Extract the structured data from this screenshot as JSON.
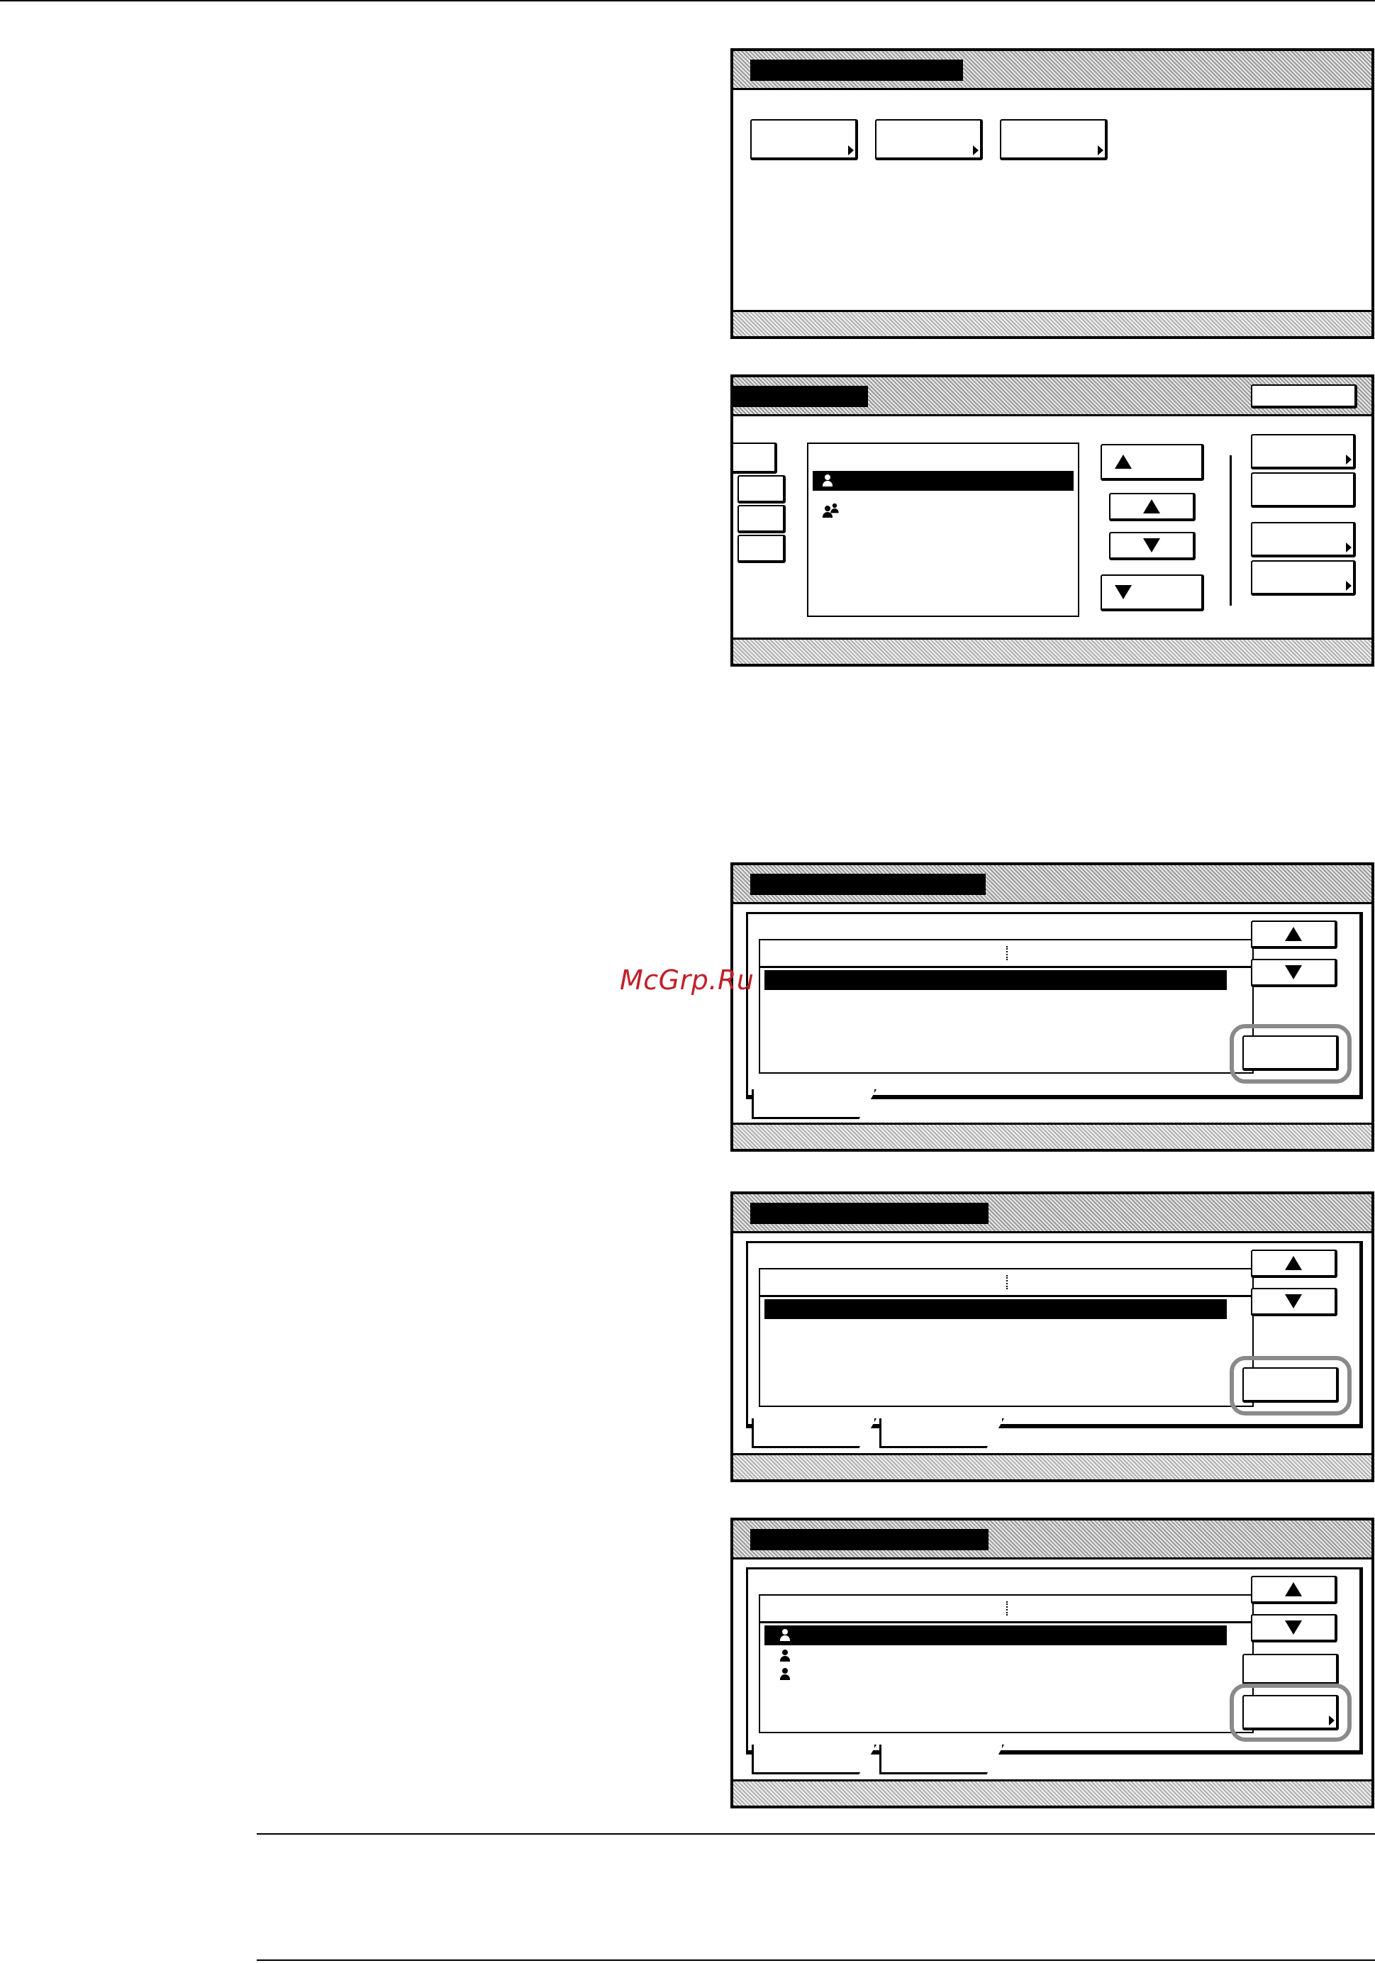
{
  "watermark": {
    "text": "McGrp.Ru"
  },
  "colors": {
    "watermark": "#c0202a",
    "highlight_ring": "#8a8a8a",
    "panel_frame": "#000000",
    "hatch": "#9a9a9a"
  },
  "panels": [
    {
      "name": "menu-panel",
      "buttons": 3
    },
    {
      "name": "box-list-panel",
      "list_icons": [
        "person-icon",
        "group-icon"
      ]
    },
    {
      "name": "select-panel-1",
      "tabs": 1
    },
    {
      "name": "select-panel-2",
      "tabs": 2
    },
    {
      "name": "select-panel-3",
      "tabs": 2,
      "list_icons": [
        "person-icon",
        "person-icon",
        "person-icon"
      ]
    }
  ]
}
